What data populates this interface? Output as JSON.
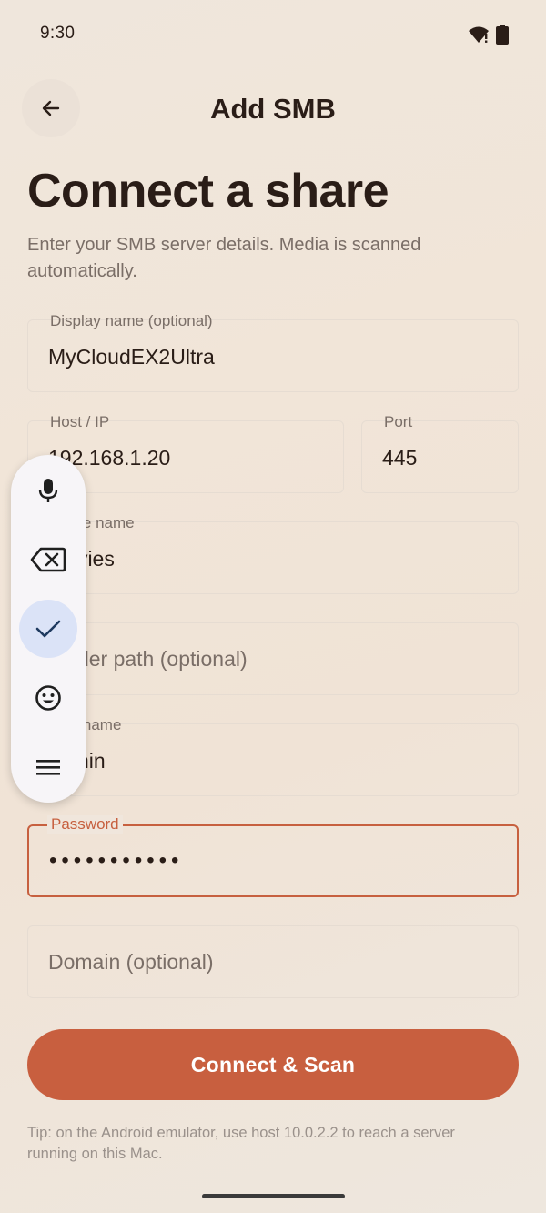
{
  "status_bar": {
    "time": "9:30",
    "icons": [
      "wifi-icon",
      "battery-icon"
    ]
  },
  "header": {
    "back_icon": "arrow-left-icon",
    "title": "Add SMB"
  },
  "headline": "Connect a share",
  "subtitle": "Enter your SMB server details. Media is scanned automatically.",
  "form": {
    "display_name": {
      "label": "Display name (optional)",
      "value": "MyCloudEX2Ultra"
    },
    "host": {
      "label": "Host / IP",
      "value": "192.168.1.20"
    },
    "port": {
      "label": "Port",
      "value": "445"
    },
    "share": {
      "label": "Share name",
      "value": "Movies"
    },
    "folder": {
      "placeholder": "Folder path (optional)"
    },
    "username": {
      "label": "Username",
      "value": "admin"
    },
    "password": {
      "label": "Password",
      "value": "•••••••••••"
    },
    "domain": {
      "placeholder": "Domain (optional)"
    }
  },
  "connect_button": "Connect & Scan",
  "tip": "Tip: on the Android emulator, use host 10.0.2.2 to reach a server running on this Mac.",
  "colors": {
    "accent": "#c85f3f",
    "background": "#f0e6dc",
    "text": "#2a1d17",
    "toolbar_selected": "#dbe3f7"
  },
  "floating_toolbar": [
    "mic-icon",
    "backspace-icon",
    "check-icon",
    "emoji-icon",
    "menu-icon"
  ]
}
